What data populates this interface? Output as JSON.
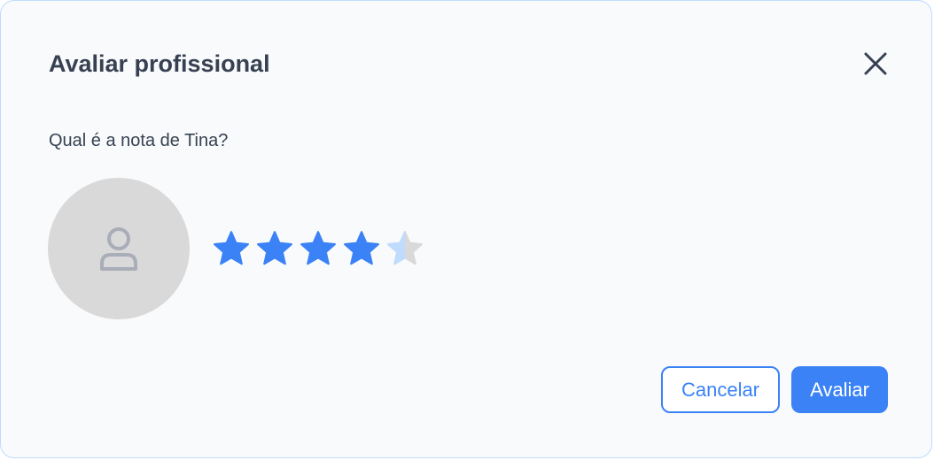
{
  "dialog": {
    "title": "Avaliar profissional",
    "question": "Qual é a nota de Tina?",
    "close_icon": "close-icon",
    "avatar_icon": "user-icon"
  },
  "rating": {
    "value": 4.5,
    "max": 5,
    "filled_color": "#3b82f6",
    "half_color": "#bfdbfe",
    "empty_color": "#d9d9d9"
  },
  "actions": {
    "cancel_label": "Cancelar",
    "submit_label": "Avaliar"
  },
  "colors": {
    "accent": "#3b82f6",
    "border": "#bfdbfe",
    "background": "#f8fafc",
    "text": "#374151"
  }
}
